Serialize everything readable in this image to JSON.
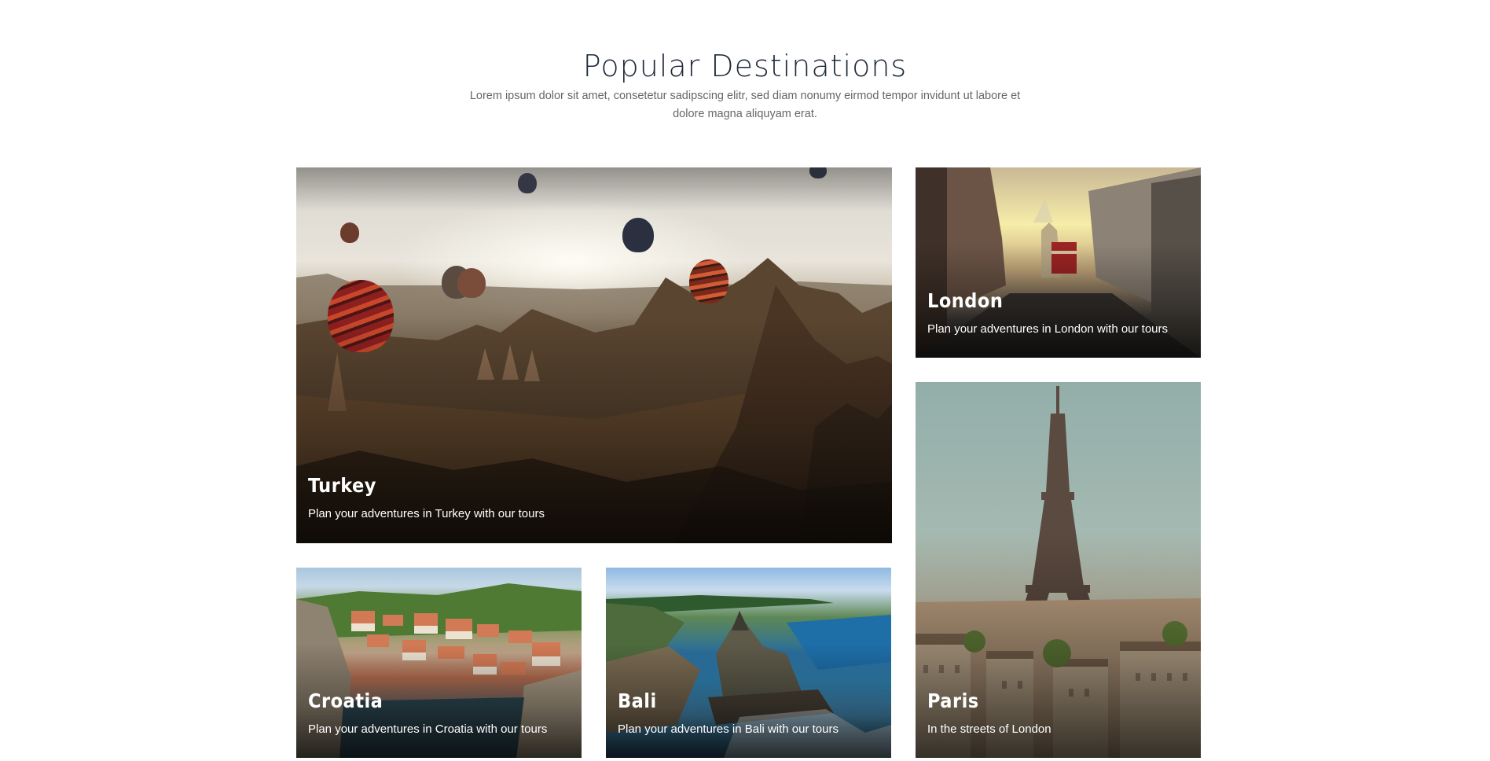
{
  "section": {
    "title": "Popular Destinations",
    "subtitle": "Lorem ipsum dolor sit amet, consetetur sadipscing elitr, sed diam nonumy eirmod tempor invidunt ut labore et dolore magna aliquyam erat."
  },
  "destinations": [
    {
      "name": "Turkey",
      "description": "Plan your adventures in Turkey with our tours"
    },
    {
      "name": "London",
      "description": "Plan your adventures in London with our tours"
    },
    {
      "name": "Croatia",
      "description": "Plan your adventures in Croatia with our tours"
    },
    {
      "name": "Bali",
      "description": "Plan your adventures in Bali with our tours"
    },
    {
      "name": "Paris",
      "description": "In the streets of London"
    }
  ]
}
